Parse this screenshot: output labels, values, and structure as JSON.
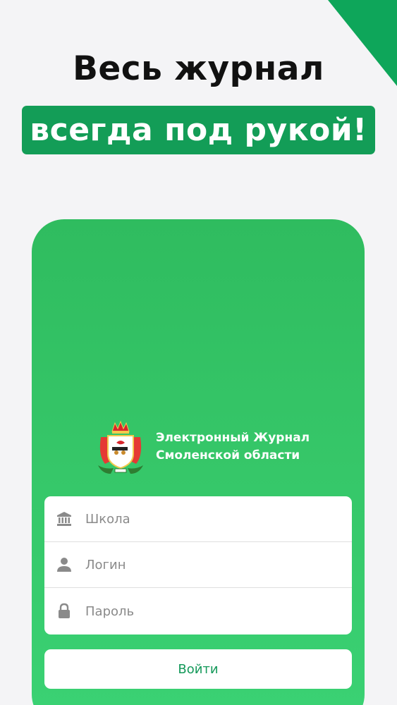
{
  "promo": {
    "headline": "Весь журнал",
    "banner": "всегда под рукой!"
  },
  "app": {
    "title_line1": "Электронный Журнал",
    "title_line2": "Смоленской области"
  },
  "form": {
    "school_placeholder": "Школа",
    "login_placeholder": "Логин",
    "password_placeholder": "Пароль",
    "submit_label": "Войти"
  },
  "colors": {
    "accent": "#139d57",
    "phone_gradient_top": "#2fbc5f",
    "phone_gradient_bottom": "#3ad274",
    "button_text": "#14995a"
  }
}
